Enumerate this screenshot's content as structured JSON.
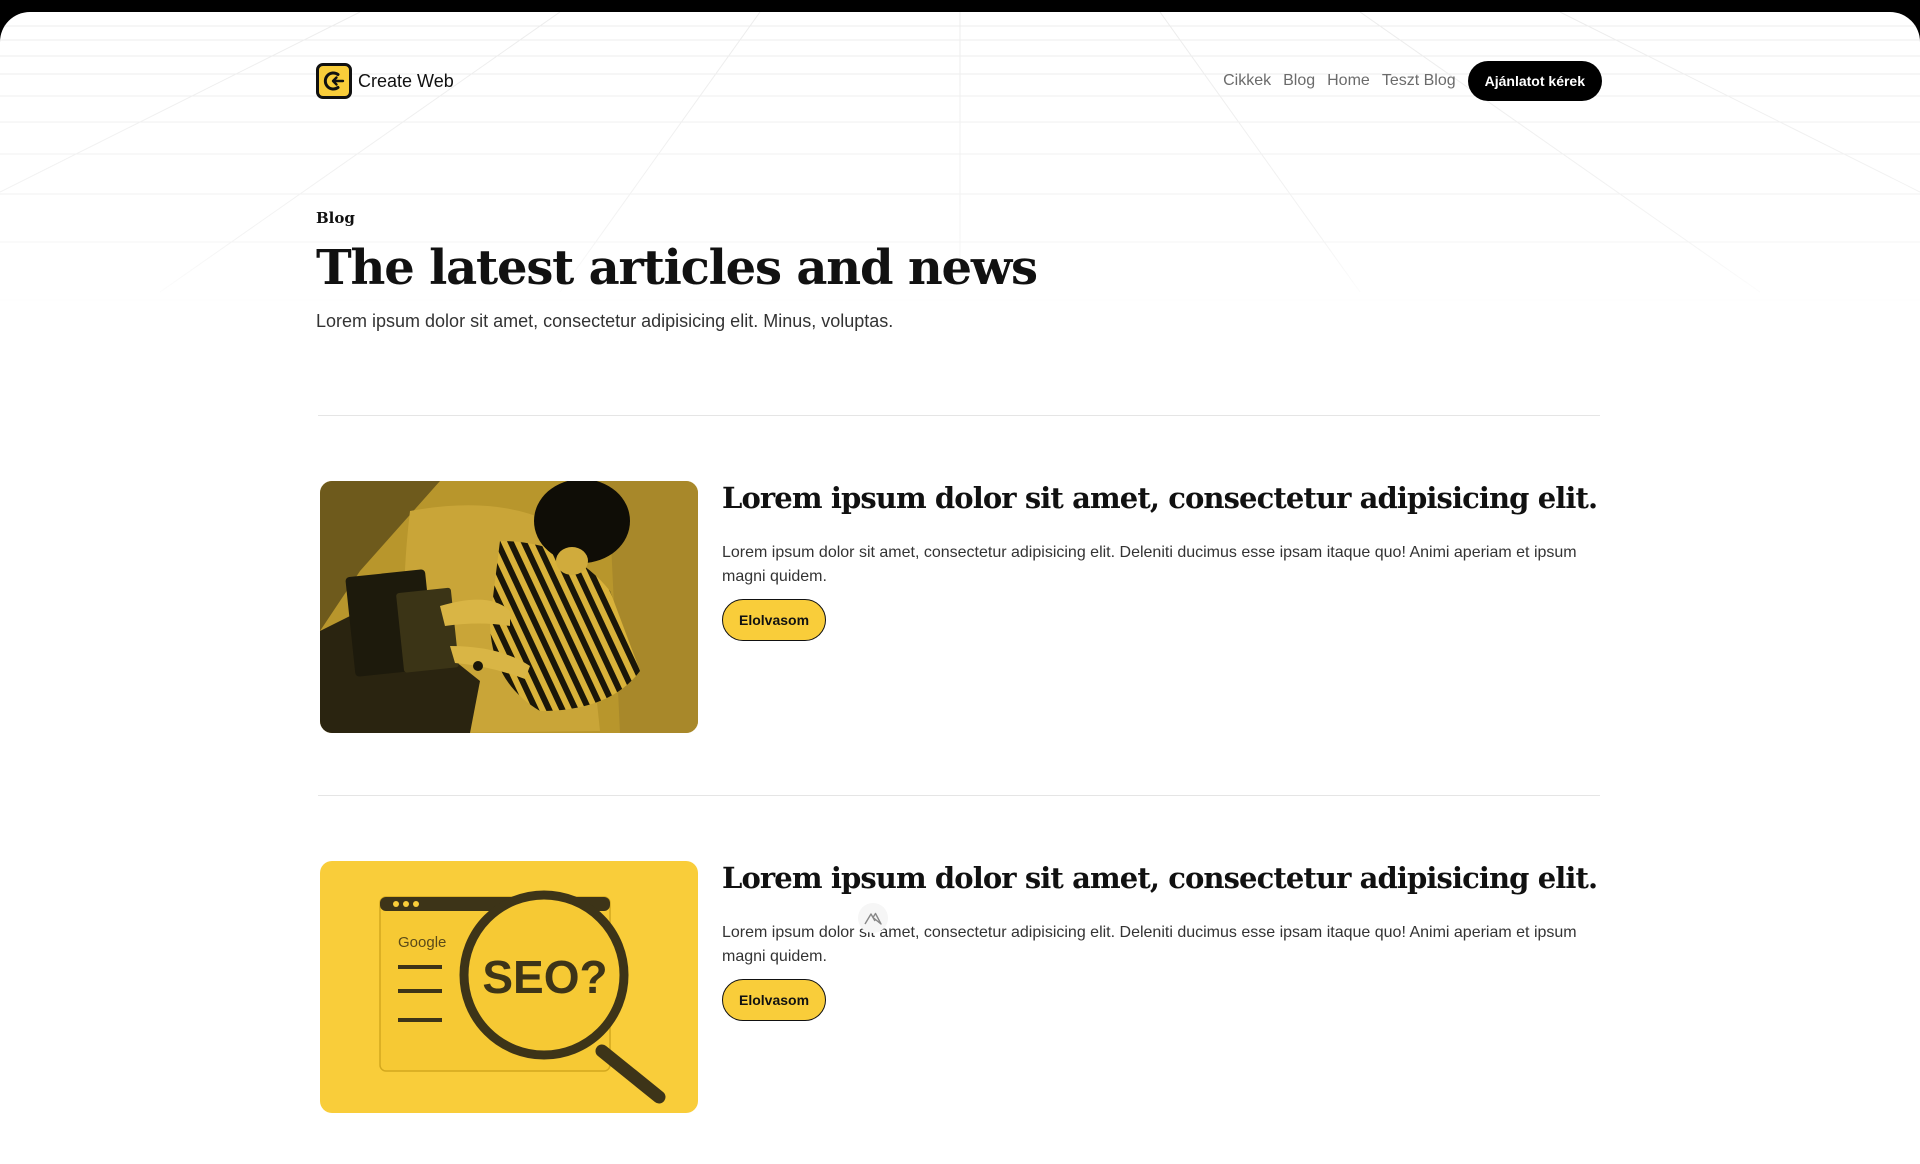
{
  "brand": {
    "name": "Create Web",
    "logo_icon": "create-web-logo-icon",
    "accent": "#f9cd3a"
  },
  "nav": {
    "items": [
      {
        "label": "Cikkek"
      },
      {
        "label": "Blog"
      },
      {
        "label": "Home"
      },
      {
        "label": "Teszt Blog"
      }
    ],
    "cta_label": "Ajánlatot kérek"
  },
  "hero": {
    "eyebrow": "Blog",
    "title": "The latest articles and news",
    "subtitle": "Lorem ipsum dolor sit amet, consectetur adipisicing elit. Minus, voluptas."
  },
  "articles": [
    {
      "title": "Lorem ipsum dolor sit amet, consectetur adipisicing elit.",
      "excerpt": "Lorem ipsum dolor sit amet, consectetur adipisicing elit. Deleniti ducimus esse ipsam itaque quo! Animi aperiam et ipsum magni quidem.",
      "button_label": "Elolvasom",
      "image": "person-with-laptop-photo"
    },
    {
      "title": "Lorem ipsum dolor sit amet, consectetur adipisicing elit.",
      "excerpt": "Lorem ipsum dolor sit amet, consectetur adipisicing elit. Deleniti ducimus esse ipsam itaque quo! Animi aperiam et ipsum magni quidem.",
      "button_label": "Elolvasom",
      "image": "seo-magnifier-illustration",
      "image_text": {
        "browser_label": "Google",
        "lens_text": "SEO?"
      }
    }
  ]
}
